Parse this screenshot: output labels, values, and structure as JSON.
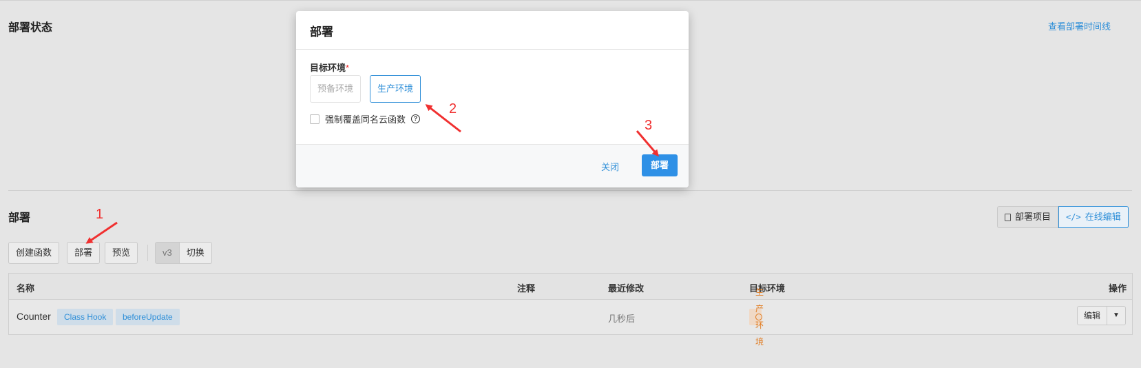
{
  "deploy_status": {
    "title": "部署状态",
    "timeline_link": "查看部署时间线"
  },
  "deploy_section": {
    "title": "部署",
    "view_buttons": [
      "部署项目",
      "在线编辑"
    ],
    "actions": {
      "create": "创建函数",
      "deploy": "部署",
      "preview": "预览"
    },
    "version": {
      "value": "v3",
      "switch": "切换"
    }
  },
  "table": {
    "headers": [
      "名称",
      "注释",
      "最近修改",
      "目标环境",
      "操作"
    ],
    "rows": [
      {
        "name": "Counter",
        "tags": [
          "Class Hook",
          "beforeUpdate"
        ],
        "comment": "",
        "modified": "几秒后",
        "env": "生产环境",
        "edit": "编辑"
      }
    ]
  },
  "modal": {
    "title": "部署",
    "field_label": "目标环境",
    "required_mark": "*",
    "options": [
      "预备环境",
      "生产环境"
    ],
    "selected": "生产环境",
    "checkbox_label": "强制覆盖同名云函数",
    "help_icon": "?",
    "close": "关闭",
    "confirm": "部署"
  },
  "annotations": [
    "1",
    "2",
    "3"
  ],
  "colors": {
    "accent": "#2f8fd8",
    "primary_button": "#2e90e6",
    "arrow": "#f03030",
    "env_tag": "#e07b21"
  }
}
